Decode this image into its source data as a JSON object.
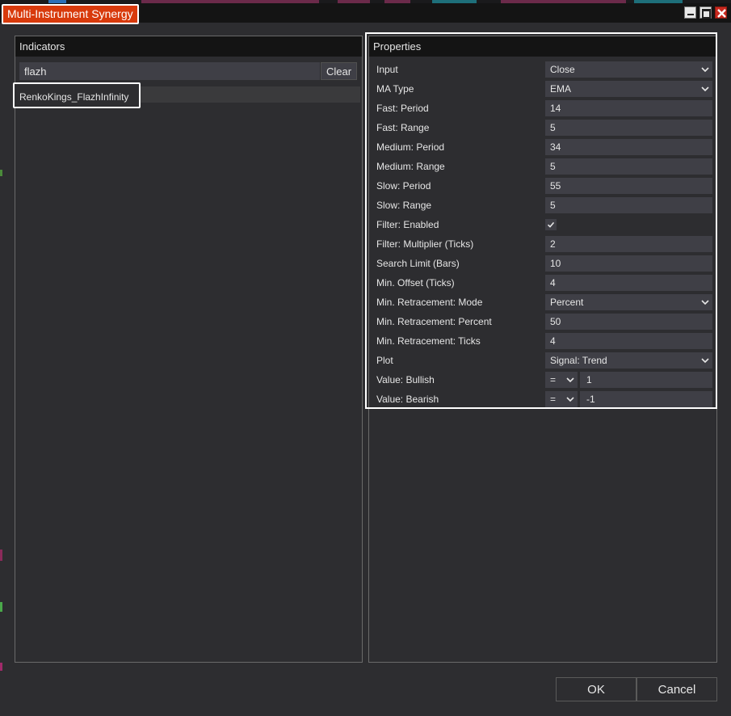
{
  "window": {
    "title": "Multi-Instrument Synergy"
  },
  "indicators_panel": {
    "header": "Indicators",
    "search": {
      "value": "flazh"
    },
    "clear_label": "Clear",
    "results": [
      "RenkoKings_FlazhInfinity"
    ]
  },
  "properties_panel": {
    "header": "Properties",
    "rows": [
      {
        "label": "Input",
        "value": "Close"
      },
      {
        "label": "MA Type",
        "value": "EMA"
      },
      {
        "label": "Fast: Period",
        "value": "14"
      },
      {
        "label": "Fast: Range",
        "value": "5"
      },
      {
        "label": "Medium: Period",
        "value": "34"
      },
      {
        "label": "Medium: Range",
        "value": "5"
      },
      {
        "label": "Slow: Period",
        "value": "55"
      },
      {
        "label": "Slow: Range",
        "value": "5"
      },
      {
        "label": "Filter: Enabled",
        "value": "true"
      },
      {
        "label": "Filter: Multiplier (Ticks)",
        "value": "2"
      },
      {
        "label": "Search Limit (Bars)",
        "value": "10"
      },
      {
        "label": "Min. Offset (Ticks)",
        "value": "4"
      },
      {
        "label": "Min. Retracement: Mode",
        "value": "Percent"
      },
      {
        "label": "Min. Retracement: Percent",
        "value": "50"
      },
      {
        "label": "Min. Retracement: Ticks",
        "value": "4"
      },
      {
        "label": "Plot",
        "value": "Signal: Trend"
      },
      {
        "label": "Value: Bullish",
        "operator": "=",
        "value": "1"
      },
      {
        "label": "Value: Bearish",
        "operator": "=",
        "value": "-1"
      }
    ]
  },
  "footer": {
    "ok_label": "OK",
    "cancel_label": "Cancel"
  },
  "colors": {
    "background": "#2d2d30",
    "header": "#141414",
    "field": "#3f3f46",
    "title_accent": "#d83a0c",
    "highlight_border": "#ffffff"
  }
}
